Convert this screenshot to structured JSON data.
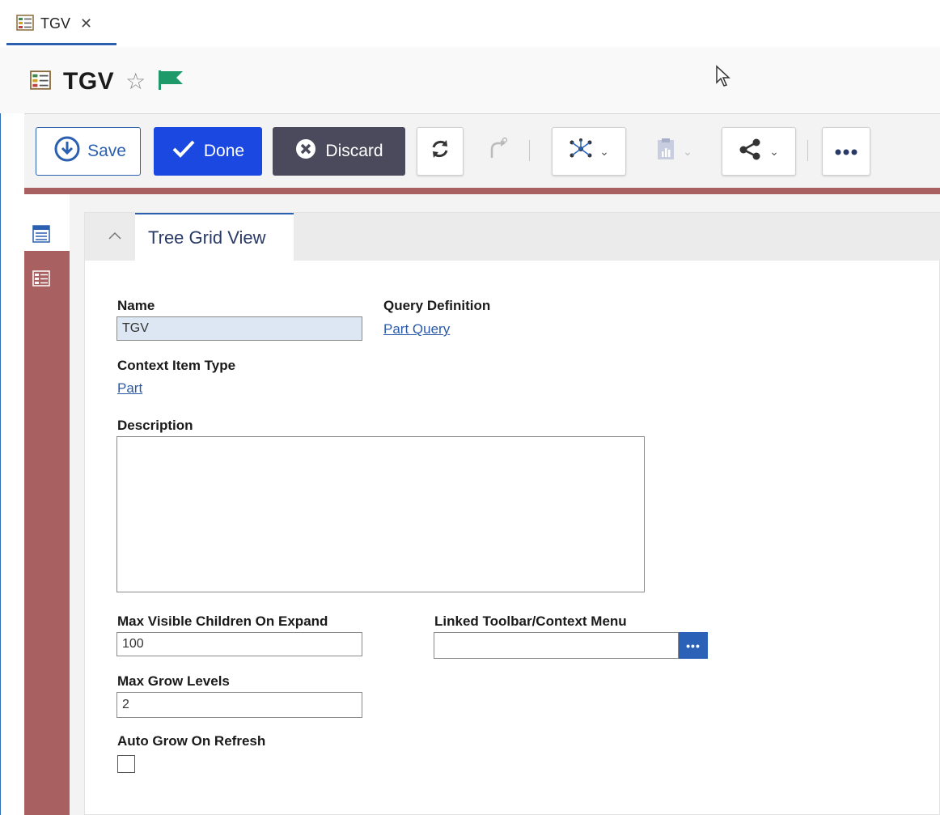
{
  "tab": {
    "label": "TGV",
    "close": "✕"
  },
  "header": {
    "title": "TGV"
  },
  "toolbar": {
    "save_label": "Save",
    "done_label": "Done",
    "discard_label": "Discard"
  },
  "section": {
    "tab_label": "Tree Grid View"
  },
  "form": {
    "name_label": "Name",
    "name_value": "TGV",
    "query_label": "Query Definition",
    "query_value": "Part Query",
    "context_label": "Context Item Type",
    "context_value": "Part",
    "description_label": "Description",
    "description_value": "",
    "max_children_label": "Max Visible Children On Expand",
    "max_children_value": "100",
    "linked_toolbar_label": "Linked Toolbar/Context Menu",
    "linked_toolbar_value": "",
    "linked_toolbar_button": "•••",
    "max_grow_label": "Max Grow Levels",
    "max_grow_value": "2",
    "auto_grow_label": "Auto Grow On Refresh",
    "auto_grow_checked": false
  },
  "colors": {
    "accent_blue": "#2b5fb0",
    "done_blue": "#1a48e0",
    "discard_dark": "#4a4a5c",
    "rail_red": "#a86060",
    "flag_green": "#1e9a6a"
  },
  "icons": [
    "tgv-tab-icon",
    "tgv-title-icon",
    "star-icon",
    "flag-icon",
    "save-icon",
    "checkmark-icon",
    "discard-icon",
    "refresh-icon",
    "redo-icon",
    "network-icon",
    "report-icon",
    "share-icon",
    "more-icon",
    "form-icon",
    "tree-grid-icon",
    "collapse-icon"
  ]
}
